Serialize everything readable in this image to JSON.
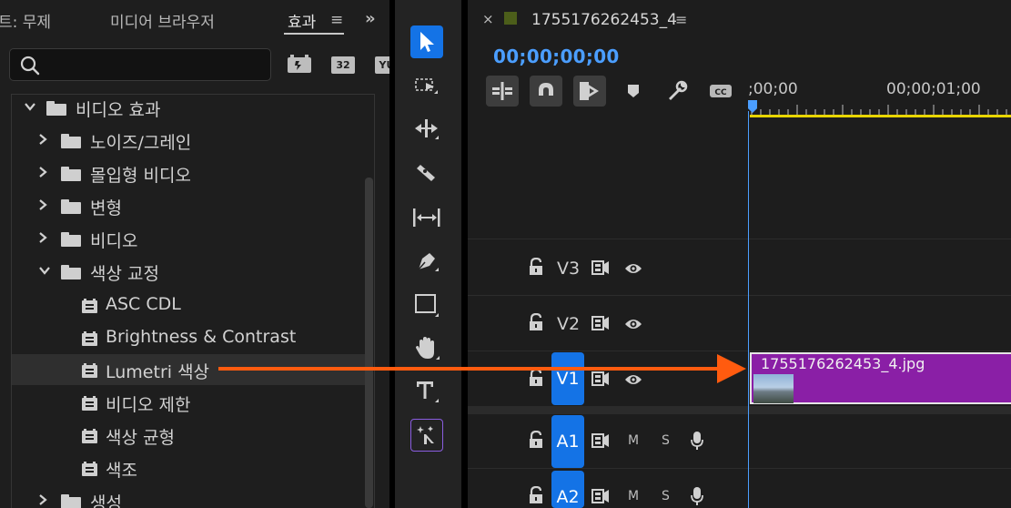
{
  "effects_panel": {
    "tabs": [
      {
        "label": "트: 무제"
      },
      {
        "label": "미디어 브라우저"
      },
      {
        "label": "효과"
      }
    ],
    "menu_icon": "hamburger-menu-icon",
    "overflow_icon": "double-chevron-right-icon",
    "search": {
      "value": "",
      "placeholder": ""
    },
    "filters": [
      {
        "icon": "accelerated-effects-icon",
        "text": ""
      },
      {
        "icon": "32bit-color-icon",
        "text": "32"
      },
      {
        "icon": "yuv-effects-icon",
        "text": "YU"
      }
    ],
    "tree": [
      {
        "label": "비디오 효과",
        "type": "folder",
        "expanded": true
      },
      {
        "label": "노이즈/그레인",
        "type": "folder",
        "expanded": false
      },
      {
        "label": "몰입형 비디오",
        "type": "folder",
        "expanded": false
      },
      {
        "label": "변형",
        "type": "folder",
        "expanded": false
      },
      {
        "label": "비디오",
        "type": "folder",
        "expanded": false
      },
      {
        "label": "색상 교정",
        "type": "folder",
        "expanded": true
      },
      {
        "label": "ASC CDL",
        "type": "effect"
      },
      {
        "label": "Brightness & Contrast",
        "type": "effect"
      },
      {
        "label": "Lumetri 색상",
        "type": "effect",
        "selected": true
      },
      {
        "label": "비디오 제한",
        "type": "effect"
      },
      {
        "label": "색상 균형",
        "type": "effect"
      },
      {
        "label": "색조",
        "type": "effect"
      },
      {
        "label": "생성",
        "type": "folder",
        "expanded": false
      }
    ]
  },
  "tools": [
    {
      "name": "selection-tool",
      "icon": "arrow-pointer-icon",
      "active": true
    },
    {
      "name": "track-select-tool",
      "icon": "track-select-icon"
    },
    {
      "name": "ripple-edit-tool",
      "icon": "ripple-edit-icon"
    },
    {
      "name": "razor-tool",
      "icon": "razor-icon"
    },
    {
      "name": "slip-tool",
      "icon": "slip-icon"
    },
    {
      "name": "pen-tool",
      "icon": "pen-icon"
    },
    {
      "name": "rectangle-tool",
      "icon": "rectangle-icon"
    },
    {
      "name": "hand-tool",
      "icon": "hand-icon"
    },
    {
      "name": "type-tool",
      "icon": "type-icon"
    },
    {
      "name": "remix-tool",
      "icon": "sparkle-edit-icon"
    }
  ],
  "timeline": {
    "sequence_name": "1755176262453_4",
    "close_label": "×",
    "menu_label": "≡",
    "timecode": "00;00;00;00",
    "ruler": {
      "start_label": ";00;00",
      "mark_label": "00;00;01;00"
    },
    "toolbar": [
      {
        "icon": "insert-sequence-nest-icon"
      },
      {
        "icon": "snap-magnet-icon"
      },
      {
        "icon": "linked-selection-icon"
      },
      {
        "icon": "add-marker-icon"
      },
      {
        "icon": "wrench-settings-icon"
      },
      {
        "icon": "captions-cc-icon"
      }
    ],
    "tracks": [
      {
        "label": "V3",
        "kind": "video",
        "targeted": false
      },
      {
        "label": "V2",
        "kind": "video",
        "targeted": false
      },
      {
        "label": "V1",
        "kind": "video",
        "targeted": true
      },
      {
        "label": "A1",
        "kind": "audio",
        "targeted": true,
        "mute": "M",
        "solo": "S"
      },
      {
        "label": "A2",
        "kind": "audio",
        "targeted": true,
        "mute": "M",
        "solo": "S"
      }
    ],
    "clip": {
      "name": "1755176262453_4.jpg",
      "track": "V1"
    }
  },
  "colors": {
    "accent_blue": "#1473e6",
    "timecode_blue": "#4b9eff",
    "clip_purple": "#8a1fa6",
    "work_area_yellow": "#e8d500",
    "arrow_orange": "#ff5b0f"
  }
}
